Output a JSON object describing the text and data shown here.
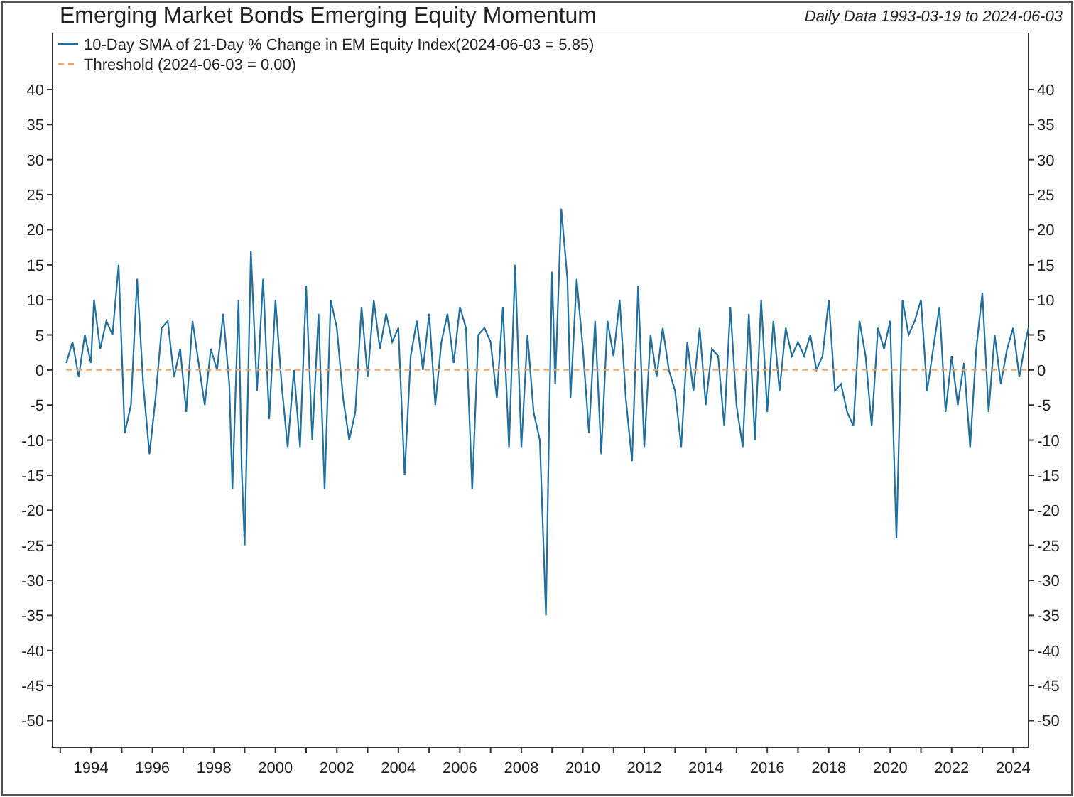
{
  "header": {
    "subtitle": "Daily Data 1993-03-19 to 2024-06-03"
  },
  "chart": {
    "chart_data": {
      "type": "line",
      "title": "Emerging Market Bonds Emerging Equity Momentum",
      "x": [
        1993.2,
        1993.4,
        1993.6,
        1993.8,
        1994.0,
        1994.1,
        1994.3,
        1994.5,
        1994.7,
        1994.9,
        1995.1,
        1995.3,
        1995.5,
        1995.7,
        1995.9,
        1996.1,
        1996.3,
        1996.5,
        1996.7,
        1996.9,
        1997.1,
        1997.3,
        1997.5,
        1997.7,
        1997.9,
        1998.1,
        1998.3,
        1998.5,
        1998.6,
        1998.8,
        1998.9,
        1999.0,
        1999.2,
        1999.4,
        1999.6,
        1999.8,
        2000.0,
        2000.2,
        2000.4,
        2000.6,
        2000.8,
        2001.0,
        2001.2,
        2001.4,
        2001.6,
        2001.8,
        2002.0,
        2002.2,
        2002.4,
        2002.6,
        2002.8,
        2003.0,
        2003.2,
        2003.4,
        2003.6,
        2003.8,
        2004.0,
        2004.2,
        2004.4,
        2004.6,
        2004.8,
        2005.0,
        2005.2,
        2005.4,
        2005.6,
        2005.8,
        2006.0,
        2006.2,
        2006.4,
        2006.6,
        2006.8,
        2007.0,
        2007.2,
        2007.4,
        2007.6,
        2007.8,
        2008.0,
        2008.2,
        2008.4,
        2008.6,
        2008.8,
        2008.9,
        2009.0,
        2009.1,
        2009.3,
        2009.5,
        2009.6,
        2009.8,
        2010.0,
        2010.2,
        2010.4,
        2010.6,
        2010.8,
        2011.0,
        2011.2,
        2011.4,
        2011.6,
        2011.8,
        2012.0,
        2012.2,
        2012.4,
        2012.6,
        2012.8,
        2013.0,
        2013.2,
        2013.4,
        2013.6,
        2013.8,
        2014.0,
        2014.2,
        2014.4,
        2014.6,
        2014.8,
        2015.0,
        2015.2,
        2015.4,
        2015.6,
        2015.8,
        2016.0,
        2016.2,
        2016.4,
        2016.6,
        2016.8,
        2017.0,
        2017.2,
        2017.4,
        2017.6,
        2017.8,
        2018.0,
        2018.2,
        2018.4,
        2018.6,
        2018.8,
        2019.0,
        2019.2,
        2019.4,
        2019.6,
        2019.8,
        2020.0,
        2020.2,
        2020.4,
        2020.6,
        2020.8,
        2021.0,
        2021.2,
        2021.4,
        2021.6,
        2021.8,
        2022.0,
        2022.2,
        2022.4,
        2022.6,
        2022.8,
        2023.0,
        2023.2,
        2023.4,
        2023.6,
        2023.8,
        2024.0,
        2024.2,
        2024.4,
        2024.5
      ],
      "series": [
        {
          "name": "10-Day SMA of 21-Day % Change in EM Equity Index(2024-06-03 = 5.85)",
          "color": "#1f6f9f",
          "line_style": "solid",
          "values": [
            1,
            4,
            -1,
            5,
            1,
            10,
            3,
            7,
            5,
            15,
            -9,
            -5,
            13,
            -2,
            -12,
            -4,
            6,
            7,
            -1,
            3,
            -6,
            7,
            1,
            -5,
            3,
            0,
            8,
            -2,
            -17,
            10,
            -14,
            -25,
            17,
            -3,
            13,
            -7,
            10,
            -2,
            -11,
            0,
            -11,
            12,
            -10,
            8,
            -17,
            10,
            6,
            -4,
            -10,
            -6,
            9,
            -1,
            10,
            3,
            8,
            4,
            6,
            -15,
            2,
            7,
            0,
            8,
            -5,
            4,
            8,
            1,
            9,
            6,
            -17,
            5,
            6,
            4,
            -4,
            9,
            -11,
            15,
            -11,
            5,
            -6,
            -10,
            -35,
            -8,
            14,
            -2,
            23,
            13,
            -4,
            13,
            3,
            -9,
            7,
            -12,
            7,
            2,
            10,
            -4,
            -13,
            12,
            -11,
            5,
            -1,
            6,
            0,
            -3,
            -11,
            4,
            -3,
            6,
            -5,
            3,
            2,
            -8,
            9,
            -5,
            -11,
            8,
            -10,
            10,
            -6,
            7,
            -3,
            6,
            2,
            4,
            2,
            5,
            0,
            2,
            10,
            -3,
            -2,
            -6,
            -8,
            7,
            2,
            -8,
            6,
            3,
            7,
            -24,
            10,
            5,
            7,
            10,
            -3,
            3,
            9,
            -6,
            2,
            -5,
            1,
            -11,
            3,
            11,
            -6,
            5,
            -2,
            3,
            6,
            -1,
            4,
            6
          ]
        },
        {
          "name": "Threshold (2024-06-03 = 0.00)",
          "color": "#f4a460",
          "line_style": "dashed",
          "values": [
            0,
            0,
            0,
            0,
            0,
            0,
            0,
            0,
            0,
            0,
            0,
            0,
            0,
            0,
            0,
            0,
            0,
            0,
            0,
            0,
            0,
            0,
            0,
            0,
            0,
            0,
            0,
            0,
            0,
            0,
            0,
            0,
            0,
            0,
            0,
            0,
            0,
            0,
            0,
            0,
            0,
            0,
            0,
            0,
            0,
            0,
            0,
            0,
            0,
            0,
            0,
            0,
            0,
            0,
            0,
            0,
            0,
            0,
            0,
            0,
            0,
            0,
            0,
            0,
            0,
            0,
            0,
            0,
            0,
            0,
            0,
            0,
            0,
            0,
            0,
            0,
            0,
            0,
            0,
            0,
            0,
            0,
            0,
            0,
            0,
            0,
            0,
            0,
            0,
            0,
            0,
            0,
            0,
            0,
            0,
            0,
            0,
            0,
            0,
            0,
            0,
            0,
            0,
            0,
            0,
            0,
            0,
            0,
            0,
            0,
            0,
            0,
            0,
            0,
            0,
            0,
            0,
            0,
            0,
            0,
            0,
            0,
            0,
            0,
            0,
            0,
            0,
            0,
            0,
            0,
            0,
            0,
            0,
            0,
            0,
            0,
            0,
            0,
            0,
            0,
            0,
            0,
            0,
            0,
            0,
            0,
            0,
            0,
            0,
            0,
            0,
            0,
            0,
            0,
            0,
            0,
            0,
            0,
            0,
            0,
            0,
            0
          ]
        }
      ],
      "legend": "upper left",
      "xlim": [
        1992.75,
        2024.5
      ],
      "ylim": [
        -53.8,
        48.1
      ],
      "xticks": [
        1994,
        1996,
        1998,
        2000,
        2002,
        2004,
        2006,
        2008,
        2010,
        2012,
        2014,
        2016,
        2018,
        2020,
        2022,
        2024
      ],
      "yticks": [
        40,
        35,
        30,
        25,
        20,
        15,
        10,
        5,
        0,
        -5,
        -10,
        -15,
        -20,
        -25,
        -30,
        -35,
        -40,
        -45,
        -50
      ]
    },
    "left_axis": {
      "tick_labels": [
        "40",
        "35",
        "30",
        "25",
        "20",
        "15",
        "10",
        "5",
        "0",
        "-5",
        "-10",
        "-15",
        "-20",
        "-25",
        "-30",
        "-35",
        "-40",
        "-45",
        "-50"
      ]
    },
    "right_axis": {
      "tick_labels": [
        "40",
        "35",
        "30",
        "25",
        "20",
        "15",
        "10",
        "5",
        "0",
        "-5",
        "-10",
        "-15",
        "-20",
        "-25",
        "-30",
        "-35",
        "-40",
        "-45",
        "-50"
      ]
    }
  }
}
